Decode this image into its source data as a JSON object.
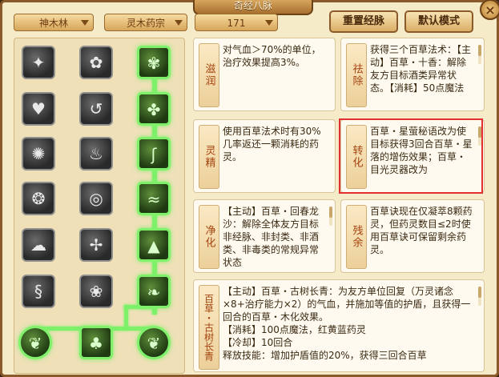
{
  "window": {
    "title": "奇经八脉",
    "close_glyph": "×"
  },
  "filters": {
    "sect": "神木林",
    "school": "灵木药宗",
    "level": "171"
  },
  "buttons": {
    "reset": "重置经脉",
    "default": "默认模式"
  },
  "icons": {
    "nodes": [
      "leaf-icon",
      "herb-icon",
      "spiral-icon",
      "heart-icon",
      "swirl-icon",
      "cross-leaf-icon",
      "fire-icon",
      "flame-icon",
      "vine-icon",
      "wreath-icon",
      "swirl-icon",
      "wave-icon",
      "cloud-icon",
      "rabbit-icon",
      "mountain-icon",
      "scroll-icon",
      "curl-icon",
      "sprout-icon",
      "bud-icon",
      "plant-icon",
      "bud-icon"
    ]
  },
  "skills": {
    "zirun": {
      "label": "滋润",
      "text": "对气血＞70%的单位，治疗效果提高3%。"
    },
    "qichu": {
      "label": "祛除",
      "text": "获得三个百草法术：【主动】百草・十香：解除友方目标酒类异常状态。【消耗】50点魔法"
    },
    "lingjing": {
      "label": "灵精",
      "text": "使用百草法术时有30%几率返还一颗消耗的药灵。"
    },
    "zhuanhua": {
      "label": "转化",
      "text": "百草・星萤秘语改为使目标获得3回合百草・星落的增伤效果；百草・目光灵器改为"
    },
    "jinghua": {
      "label": "净化",
      "text": "【主动】百草・回春龙沙：解除全体友方目标非经脉、非封类、非酒类、非毒类的常规异常状态"
    },
    "canyu": {
      "label": "残余",
      "text": "百草诀现在仅凝萃8颗药灵，但药灵数目≤2时使用百草诀可保留剩余药灵。"
    },
    "gushu": {
      "label": "百草・古树长青",
      "text": "【主动】百草・古树长青：为友方单位回复（万灵诸念×8+治疗能力×2）的气血，并施加等值的护盾，且获得一回合的百草・木化效果。",
      "cost": "【消耗】100点魔法，红黄蓝药灵",
      "cooldown": "【冷却】10回合",
      "extra": "释放技能：增加护盾值的20%，获得三回合百草"
    }
  }
}
